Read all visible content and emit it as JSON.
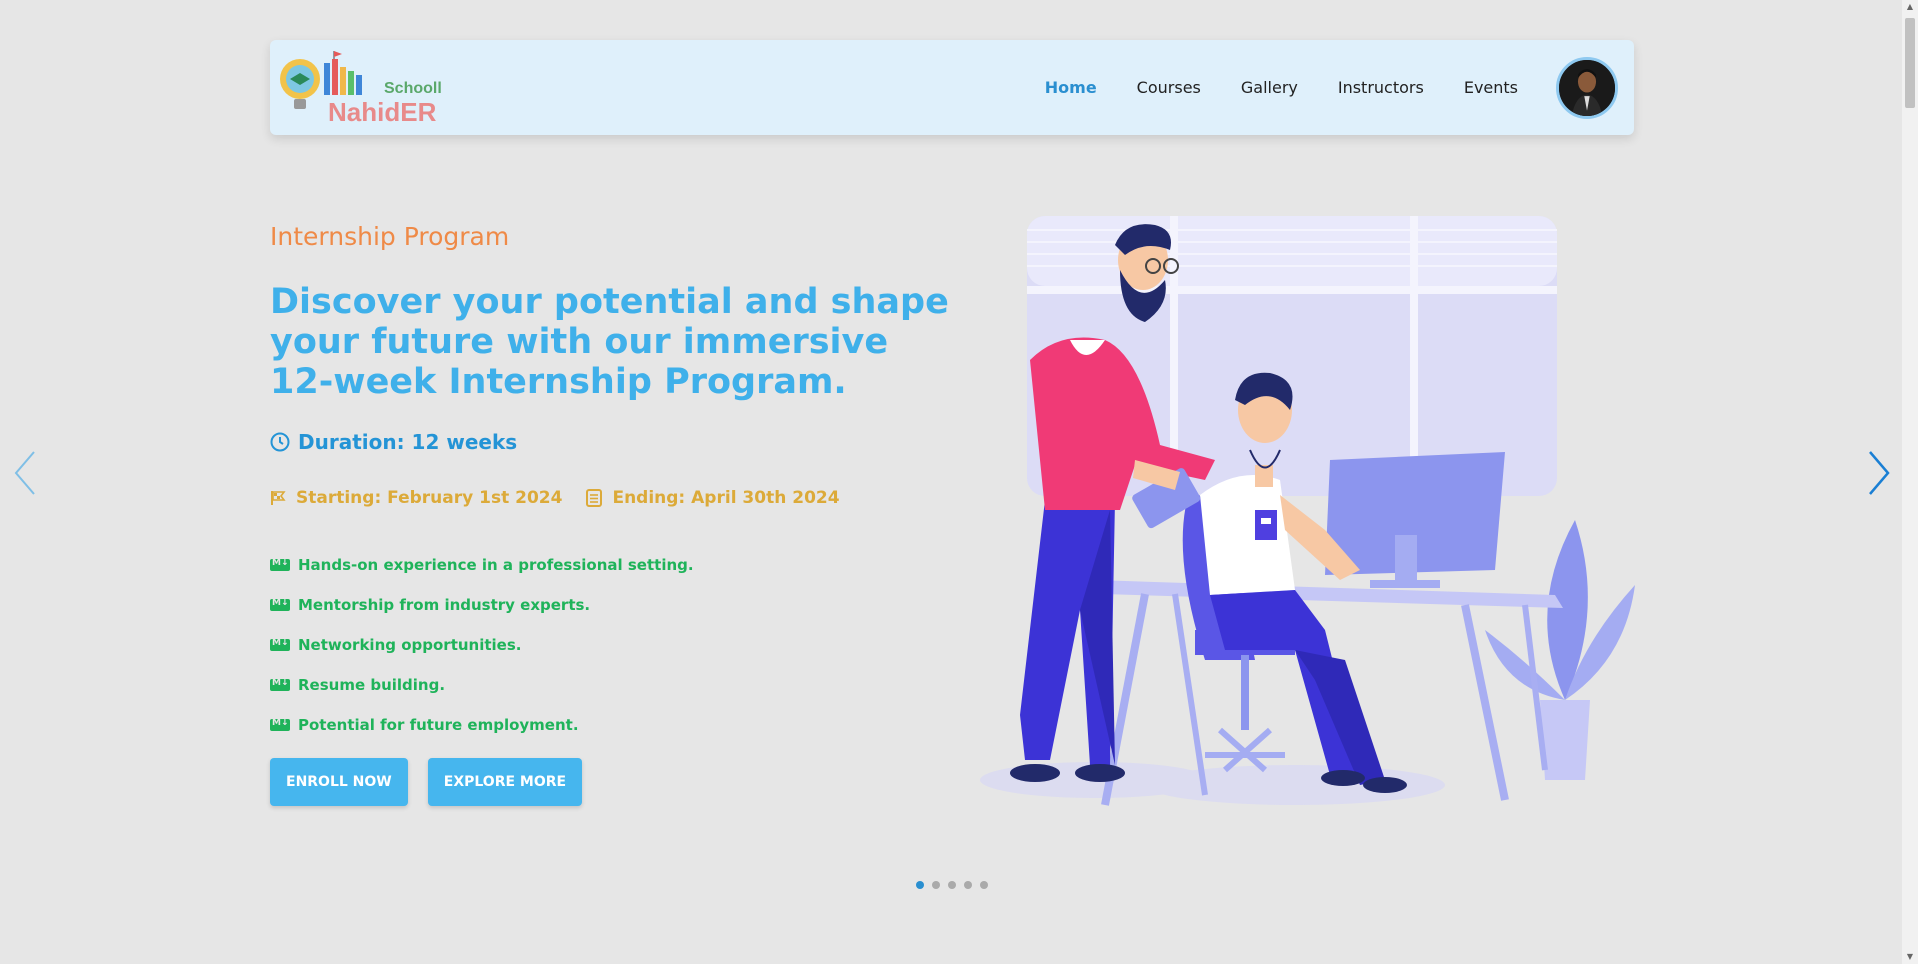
{
  "brand": {
    "logo_line1": "Schooll",
    "logo_line2": "NahidER"
  },
  "nav": {
    "items": [
      {
        "label": "Home",
        "active": true
      },
      {
        "label": "Courses"
      },
      {
        "label": "Gallery"
      },
      {
        "label": "Instructors"
      },
      {
        "label": "Events"
      }
    ]
  },
  "hero": {
    "eyebrow": "Internship Program",
    "headline": "Discover your potential and shape your future with our immersive 12-week Internship Program.",
    "duration": "Duration: 12 weeks",
    "starting": "Starting: February 1st 2024",
    "ending": "Ending: April 30th 2024",
    "features": [
      "Hands-on experience in a professional setting.",
      "Mentorship from industry experts.",
      "Networking opportunities.",
      "Resume building.",
      "Potential for future employment."
    ],
    "enroll_label": "ENROLL NOW",
    "explore_label": "EXPLORE MORE"
  },
  "carousel": {
    "slide_count": 5,
    "active_index": 0
  },
  "colors": {
    "accent_blue": "#3fb0ea",
    "eyebrow_orange": "#ef8a47",
    "date_gold": "#dcaa39",
    "feature_green": "#1fb35a",
    "navbar_bg": "#dff0fb"
  }
}
